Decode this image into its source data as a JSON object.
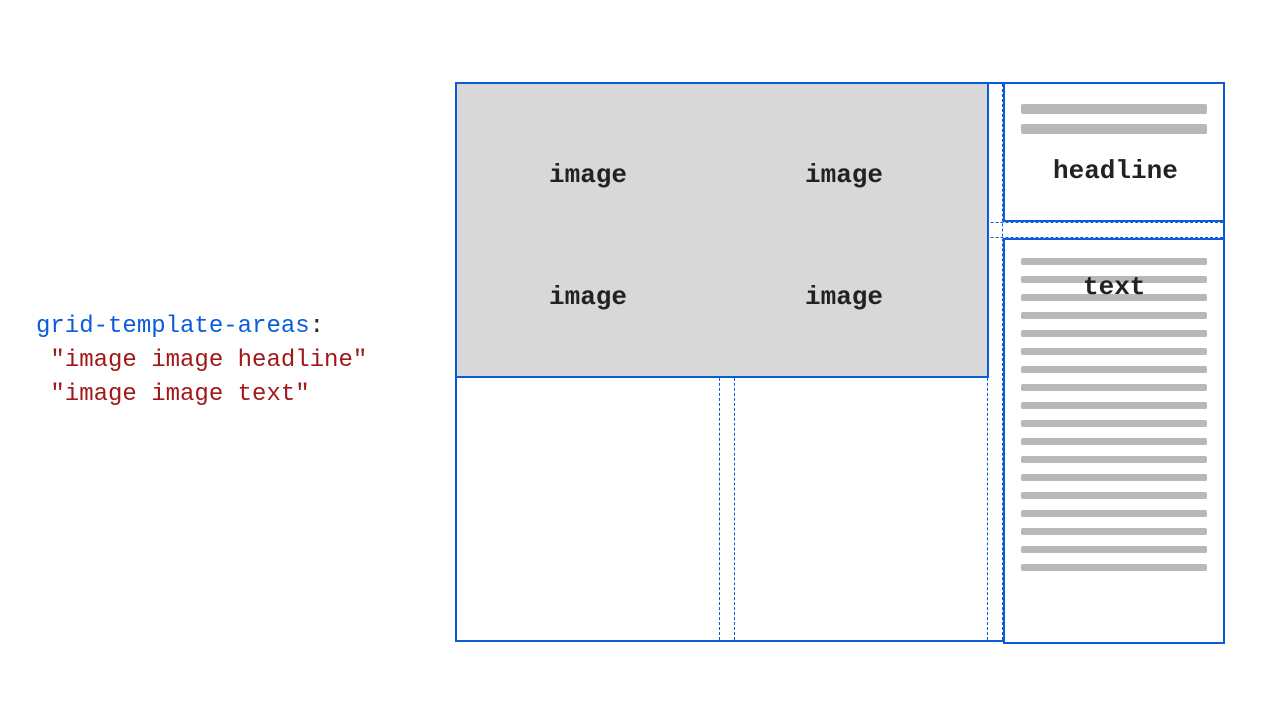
{
  "code": {
    "property": "grid-template-areas",
    "line1": "\"image image headline\"",
    "line2": "\"image image text\""
  },
  "diagram": {
    "image_cell_label": "image",
    "headline_label": "headline",
    "text_label": "text"
  }
}
